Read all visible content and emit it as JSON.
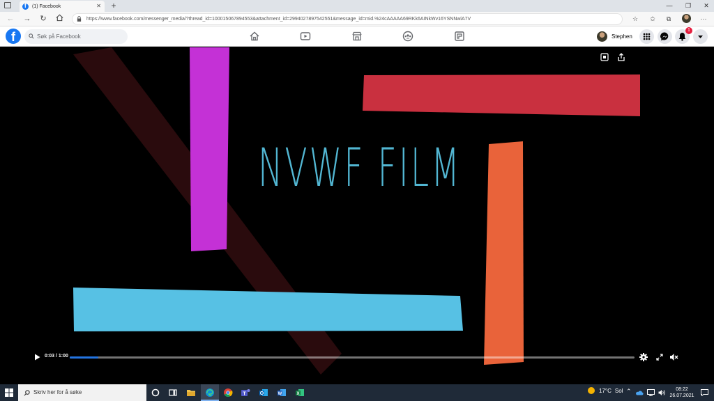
{
  "browser": {
    "tab_title": "(1) Facebook",
    "url": "https://www.facebook.com/messenger_media/?thread_id=100015067894553&attachment_id=2994027897542551&message_id=mid.%24cAAAAA69RKk6AINkWv16YSNNwiA7V"
  },
  "facebook": {
    "search_placeholder": "Søk på Facebook",
    "user_name": "Stephen",
    "notification_count": "1",
    "colors": {
      "brand": "#1877f2",
      "badge": "#e41e3f"
    }
  },
  "video": {
    "title_text": "NVWF FILM",
    "time_display": "0:03 / 1:00",
    "progress": 0.05,
    "colors": {
      "title": "#52b6d2",
      "magenta": "#c431d6",
      "red": "#c9303f",
      "orange": "#e9633a",
      "cyan": "#57c1e4",
      "progress": "#2374e1"
    }
  },
  "taskbar": {
    "search_placeholder": "Skriv her for å søke",
    "weather_temp": "17°C",
    "weather_text": "Sol",
    "time": "08:22",
    "date": "26.07.2021"
  }
}
